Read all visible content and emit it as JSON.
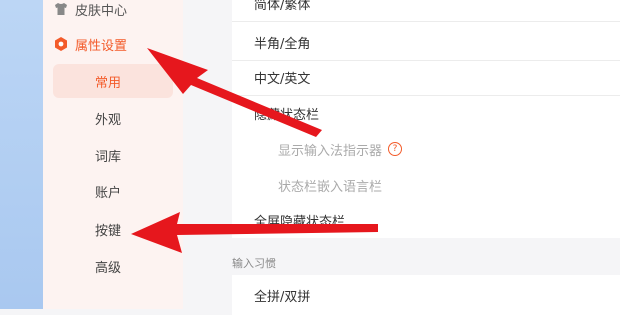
{
  "sidebar": {
    "skin": "皮肤中心",
    "props": "属性设置",
    "sub": [
      "常用",
      "外观",
      "词库",
      "账户",
      "按键",
      "高级"
    ]
  },
  "main": {
    "rows": [
      "简体/繁体",
      "半角/全角",
      "中文/英文",
      "隐藏状态栏",
      "显示输入法指示器",
      "状态栏嵌入语言栏",
      "全屏隐藏状态栏"
    ],
    "section": "输入习惯",
    "row_after_section": "全拼/双拼",
    "help_char": "?"
  },
  "colors": {
    "accent": "#f35b2a",
    "arrow": "#e6171d"
  }
}
